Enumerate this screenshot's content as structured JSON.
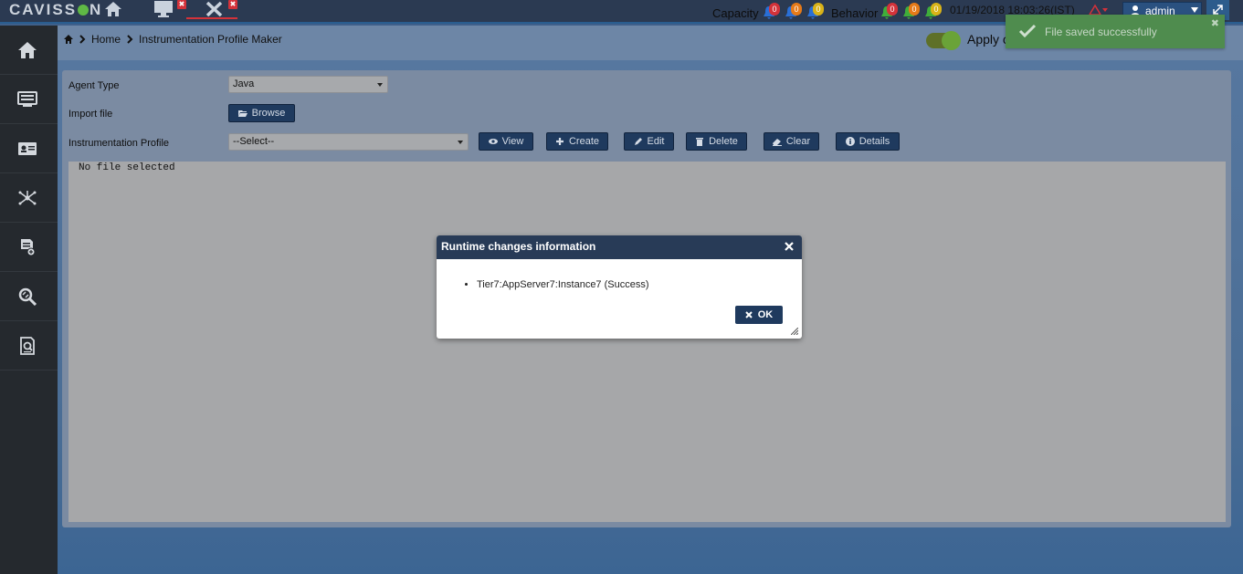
{
  "app": {
    "logo_text": "CAVISSON"
  },
  "topbar": {
    "capacity_label": "Capacity",
    "capacity_badges": [
      "0",
      "0",
      "0"
    ],
    "behavior_label": "Behavior",
    "behavior_badges": [
      "0",
      "0",
      "0"
    ],
    "datetime": "01/19/2018 18:03:26(IST)",
    "user_label": "admin"
  },
  "sidebar": {
    "items": [
      "home-icon",
      "monitor-icon",
      "id-card-icon",
      "network-icon",
      "report-icon",
      "search-analyze-icon",
      "document-search-icon"
    ]
  },
  "breadcrumb": {
    "home": "Home",
    "current": "Instrumentation Profile Maker"
  },
  "apply_label": "Apply c",
  "toast": {
    "message": "File saved successfully"
  },
  "form": {
    "agent_type_label": "Agent Type",
    "agent_type_value": "Java",
    "import_file_label": "Import file",
    "browse_label": "Browse",
    "profile_label": "Instrumentation Profile",
    "profile_value": "--Select--",
    "buttons": {
      "view": "View",
      "create": "Create",
      "edit": "Edit",
      "delete": "Delete",
      "clear": "Clear",
      "details": "Details"
    },
    "file_status": "No file selected"
  },
  "modal": {
    "title": "Runtime changes information",
    "items": [
      "Tier7:AppServer7:Instance7 (Success)"
    ],
    "ok_label": "OK"
  },
  "colors": {
    "topbar": "#2b3a52",
    "sidebar": "#25292e",
    "button": "#1f3a5e",
    "toast": "#4f8c4e",
    "badge_red": "#d4323a",
    "badge_orange": "#e67a18",
    "badge_yellow": "#d9b318"
  }
}
